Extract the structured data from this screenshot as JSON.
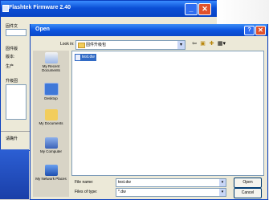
{
  "background_window": {
    "title": "Flashtek Firmware 2.40",
    "labels": [
      "固件文",
      "固件版",
      "版本:",
      "生产",
      "升级固"
    ],
    "bottom_label": "请确升"
  },
  "dialog": {
    "title": "Open",
    "look_in_label": "Look in:",
    "look_in_value": "固件升级包",
    "places": [
      {
        "label": "My Recent Documents",
        "icon": "recent-documents-icon"
      },
      {
        "label": "Desktop",
        "icon": "desktop-icon"
      },
      {
        "label": "My Documents",
        "icon": "my-documents-icon"
      },
      {
        "label": "My Computer",
        "icon": "my-computer-icon"
      },
      {
        "label": "My Network Places",
        "icon": "network-places-icon"
      }
    ],
    "files": [
      "test.dw"
    ],
    "file_name_label": "File name:",
    "file_name_value": "test.dw",
    "files_of_type_label": "Files of type:",
    "files_of_type_value": "*.dw",
    "open_button": "Open",
    "cancel_button": "Cancel"
  },
  "colors": {
    "titlebar": "#0b4fd6",
    "selection": "#316ac5",
    "close": "#e0522c"
  }
}
